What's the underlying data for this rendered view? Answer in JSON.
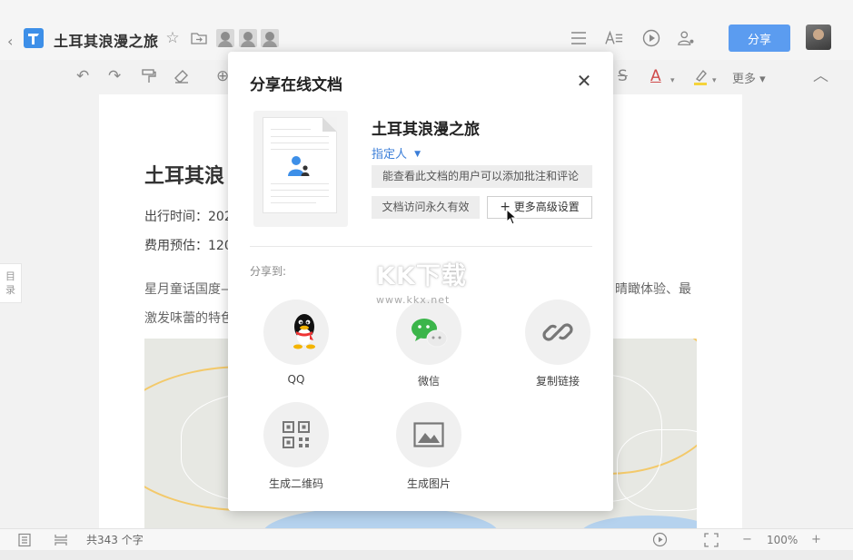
{
  "header": {
    "title": "土耳其浪漫之旅",
    "share_label": "分享"
  },
  "toolbar": {
    "more_label": "更多"
  },
  "document": {
    "heading": "土耳其浪",
    "travel_time": "出行时间：202",
    "budget": "费用预估：120",
    "para_line1": "星月童话国度—",
    "para_line1_right": "晴瞰体验、最",
    "para_line2": "激发味蕾的特色"
  },
  "toc": {
    "label": "目录"
  },
  "statusbar": {
    "word_count": "共343 个字",
    "zoom": "100%"
  },
  "modal": {
    "title": "分享在线文档",
    "doc_title": "土耳其浪漫之旅",
    "permission": "指定人",
    "permission_desc": "能查看此文档的用户可以添加批注和评论",
    "expiry": "文档访问永久有效",
    "advanced": "更多高级设置",
    "share_to": "分享到:",
    "targets": [
      {
        "label": "QQ"
      },
      {
        "label": "微信"
      },
      {
        "label": "复制链接"
      },
      {
        "label": "生成二维码"
      },
      {
        "label": "生成图片"
      }
    ]
  },
  "watermark": {
    "text": "KK下载",
    "url": "www.kkx.net"
  },
  "colors": {
    "accent": "#5b9cf0",
    "link": "#3b7ed8",
    "logo": "#3d8fe8"
  }
}
